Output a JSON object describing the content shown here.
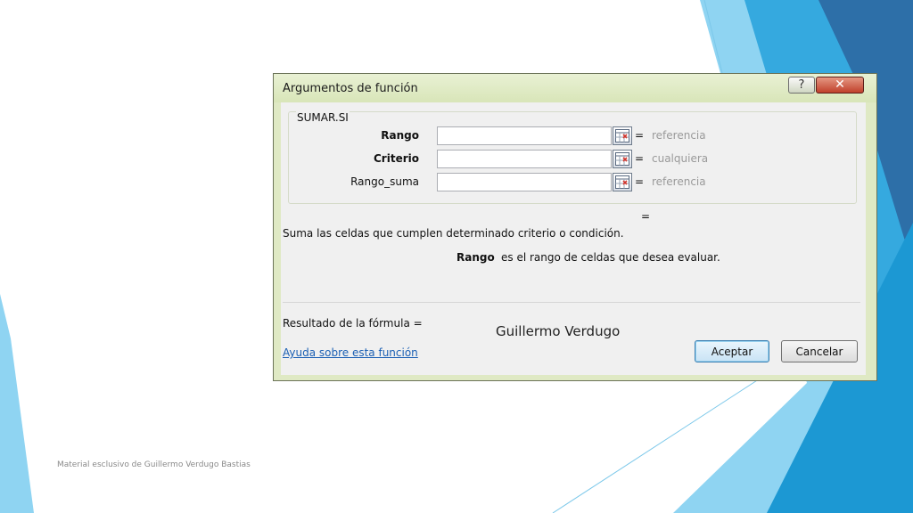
{
  "dialog": {
    "title": "Argumentos de función",
    "help_glyph": "?",
    "close_glyph": "✕",
    "function_name": "SUMAR.SI",
    "args": [
      {
        "label": "Rango",
        "bold": true,
        "value": "",
        "equals": "=",
        "hint": "referencia"
      },
      {
        "label": "Criterio",
        "bold": true,
        "value": "",
        "equals": "=",
        "hint": "cualquiera"
      },
      {
        "label": "Rango_suma",
        "bold": false,
        "value": "",
        "equals": "=",
        "hint": "referencia"
      }
    ],
    "result_equals": "=",
    "description": "Suma las celdas que cumplen determinado criterio o condición.",
    "arg_help": {
      "name": "Rango",
      "text": "es el rango de celdas que desea evaluar."
    },
    "result_label": "Resultado de la fórmula =",
    "result_value": "Guillermo Verdugo",
    "help_link": "Ayuda sobre esta función",
    "ok_label": "Aceptar",
    "cancel_label": "Cancelar"
  },
  "footer": {
    "text": "Material esclusivo de Guillermo Verdugo Bastias"
  },
  "colors": {
    "accent_dark": "#2a73ad",
    "accent_mid": "#1e9fd8",
    "accent_light": "#7fcff0"
  }
}
